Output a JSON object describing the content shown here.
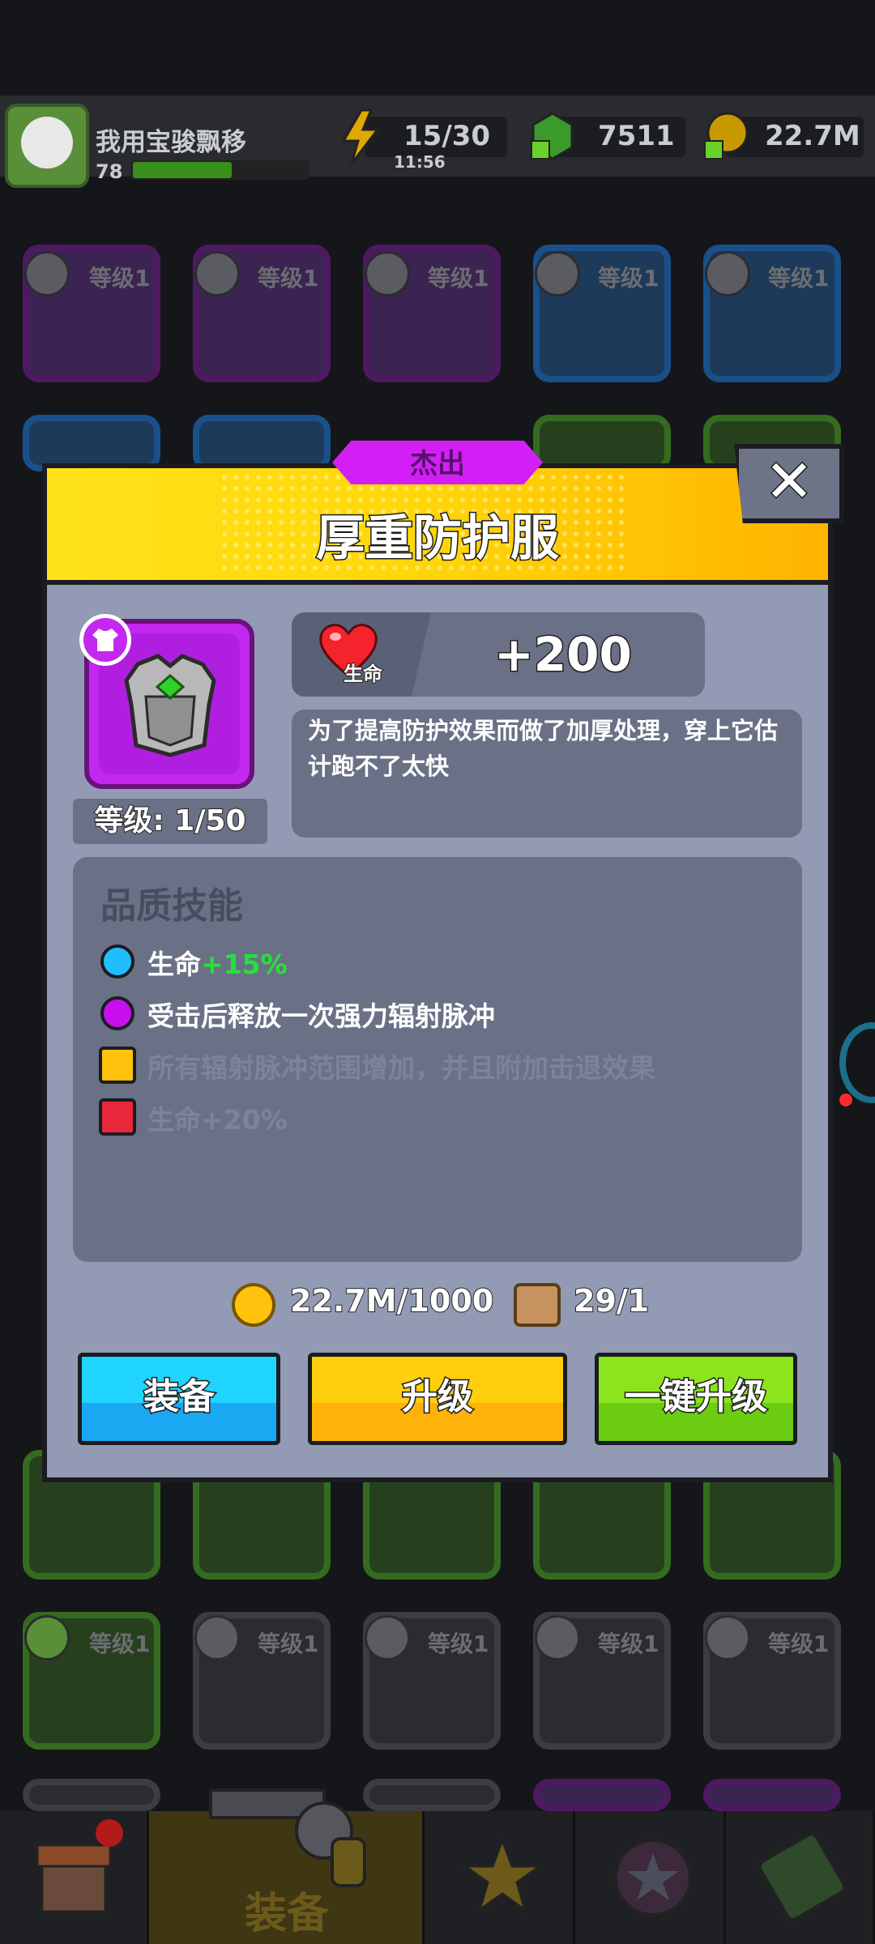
{
  "top_bar": {
    "username": "我用宝骏飘移",
    "level": "78",
    "energy": "15/30",
    "energy_timer": "11:56",
    "gems": "7511",
    "gold": "22.7M"
  },
  "background_grid": {
    "slot_label": "等级1"
  },
  "modal": {
    "rarity": "杰出",
    "title": "厚重防护服",
    "close_label": "✕",
    "item_level": "等级: 1/50",
    "stat": {
      "label": "生命",
      "value": "+200"
    },
    "description": "为了提高防护效果而做了加厚处理，穿上它估计跑不了太快",
    "quality_skills": {
      "title": "品质技能",
      "skills": [
        {
          "text": "生命",
          "bonus": "+15%"
        },
        {
          "text": "受击后释放一次强力辐射脉冲"
        },
        {
          "text": "所有辐射脉冲范围增加，并且附加击退效果"
        },
        {
          "text": "生命+20%"
        }
      ]
    },
    "cost": {
      "gold": "22.7M/1000",
      "material": "29/1"
    },
    "buttons": {
      "equip": "装备",
      "upgrade": "升级",
      "one_click_upgrade": "一键升级"
    }
  },
  "bottom_nav": {
    "active_label": "装备"
  },
  "colors": {
    "rarity_purple": "#d31ff5",
    "header_yellow": "#ffd70a",
    "skill_green": "#25e23a",
    "equip_blue": "#1fd4ff",
    "upgrade_yellow": "#ffce0c",
    "one_click_green": "#8be41e"
  }
}
